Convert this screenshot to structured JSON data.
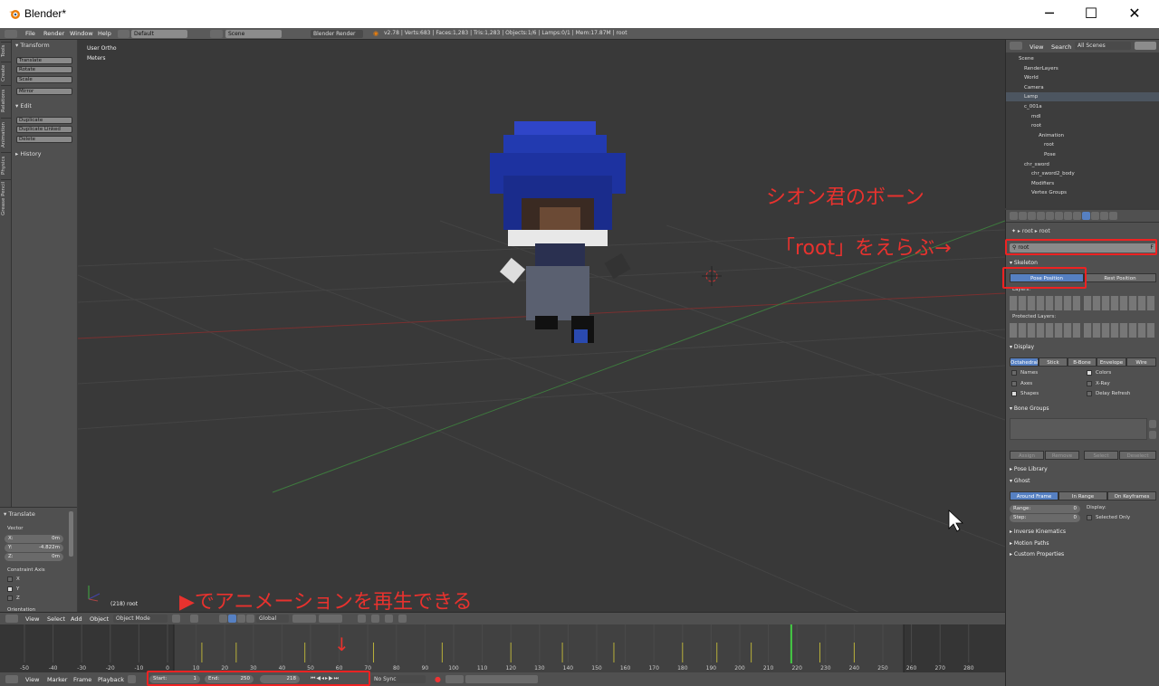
{
  "window": {
    "title": "Blender*",
    "minimize": "─",
    "maximize": "☐",
    "close": "✕"
  },
  "topbar": {
    "menus": [
      "File",
      "Render",
      "Window",
      "Help"
    ],
    "layout": "Default",
    "scene": "Scene",
    "engine": "Blender Render",
    "stats": "v2.78 | Verts:683 | Faces:1,283 | Tris:1,283 | Objects:1/6 | Lamps:0/1 | Mem:17.87M | root"
  },
  "vtabs": [
    "Tools",
    "Create",
    "Relations",
    "Animation",
    "Physics",
    "Grease Pencil"
  ],
  "toolshelf": {
    "transform": "Transform",
    "translate": "Translate",
    "rotate": "Rotate",
    "scale": "Scale",
    "mirror": "Mirror",
    "edit": "Edit",
    "duplicate": "Duplicate",
    "duplicate_linked": "Duplicate Linked",
    "delete": "Delete",
    "history": "History"
  },
  "operator": {
    "title": "Translate",
    "vector": "Vector",
    "x_label": "X:",
    "x": "0m",
    "y_label": "Y:",
    "y": "-4.822m",
    "z_label": "Z:",
    "z": "0m",
    "constraint": "Constraint Axis",
    "cx": "X",
    "cy": "Y",
    "cz": "Z",
    "orientation": "Orientation"
  },
  "viewport": {
    "view_name": "User Ortho",
    "units": "Meters",
    "object_info": "(218) root"
  },
  "viewport_header": {
    "view": "View",
    "select": "Select",
    "add": "Add",
    "object": "Object",
    "mode": "Object Mode",
    "orientation": "Global"
  },
  "timeline": {
    "ticks": [
      "-50",
      "-40",
      "-30",
      "-20",
      "-10",
      "0",
      "10",
      "20",
      "30",
      "40",
      "50",
      "60",
      "70",
      "80",
      "90",
      "100",
      "110",
      "120",
      "130",
      "140",
      "150",
      "160",
      "170",
      "180",
      "190",
      "200",
      "210",
      "220",
      "230",
      "240",
      "250",
      "260",
      "270",
      "280"
    ],
    "current_frame": 218
  },
  "timeline_header": {
    "view": "View",
    "marker": "Marker",
    "frame": "Frame",
    "playback": "Playback",
    "start_label": "Start:",
    "start": "1",
    "end_label": "End:",
    "end": "250",
    "current": "218",
    "sync": "No Sync"
  },
  "outliner": {
    "view": "View",
    "search": "Search",
    "scenes": "All Scenes",
    "items": [
      "Scene",
      "RenderLayers",
      "World",
      "Camera",
      "Lamp",
      "c_001a",
      "mdl",
      "root",
      "Animation",
      "root",
      "Pose",
      "chr_sword",
      "chr_sword2_body",
      "Modifiers",
      "Vertex Groups"
    ]
  },
  "props": {
    "breadcrumb1": "root",
    "breadcrumb2": "root",
    "armature_name": "root",
    "skeleton": "Skeleton",
    "pose_position": "Pose Position",
    "rest_position": "Rest Position",
    "layers": "Layers:",
    "protected_layers": "Protected Layers:",
    "display": "Display",
    "display_types": [
      "Octahedral",
      "Stick",
      "B-Bone",
      "Envelope",
      "Wire"
    ],
    "names": "Names",
    "axes": "Axes",
    "shapes": "Shapes",
    "colors": "Colors",
    "xray": "X-Ray",
    "delay_refresh": "Delay Refresh",
    "bone_groups": "Bone Groups",
    "assign": "Assign",
    "remove": "Remove",
    "select": "Select",
    "deselect": "Deselect",
    "pose_library": "Pose Library",
    "ghost": "Ghost",
    "ghost_types": [
      "Around Frame",
      "In Range",
      "On Keyframes"
    ],
    "range_label": "Range:",
    "range": "0",
    "step_label": "Step:",
    "step": "0",
    "display_label": "Display:",
    "selected_only": "Selected Only",
    "ik": "Inverse Kinematics",
    "motion_paths": "Motion Paths",
    "custom_properties": "Custom Properties"
  },
  "annotations": {
    "bone": "シオン君のボーン",
    "choose_root": "「root」をえらぶ→",
    "play": "▶でアニメーションを再生できる",
    "arrow": "↓"
  },
  "colors": {
    "accent": "#5680c2",
    "annotation": "#e8322e",
    "selected_frame": "#44cc44"
  }
}
